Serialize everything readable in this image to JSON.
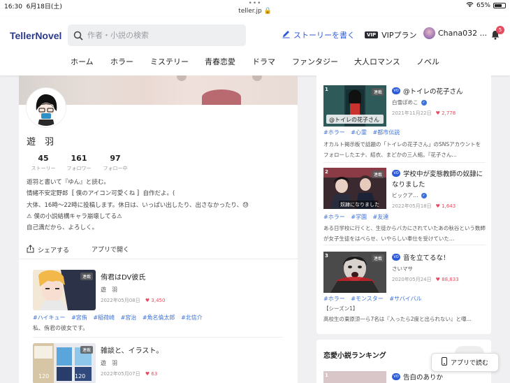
{
  "status": {
    "time": "16:30",
    "date": "6月18日(土)",
    "url": "teller.jp",
    "battery": "65%"
  },
  "header": {
    "logo": "TellerNovel",
    "search_placeholder": "作者・小説の検索",
    "write_label": "ストーリーを書く",
    "vip_tag": "VIP",
    "vip_label": "VIPプラン",
    "user_name": "Chana032 ...",
    "notification_count": "5"
  },
  "nav": [
    "ホーム",
    "ホラー",
    "ミステリー",
    "青春恋愛",
    "ドラマ",
    "ファンタジー",
    "大人ロマンス",
    "ノベル"
  ],
  "profile": {
    "name": "遊　羽",
    "stats": [
      {
        "value": "45",
        "label": "ストーリー"
      },
      {
        "value": "161",
        "label": "フォロワー"
      },
      {
        "value": "97",
        "label": "フォロー中"
      }
    ],
    "bio": [
      "遊羽と書いて『ゆん』と読む。",
      "情緒不安定野郎〚 僕のアイコン可愛くね 〛自作だよ。(",
      "大体、16時〜22時に投稿します。休日は、いっぱい出したり、出さなかったり、😓",
      "⚠ 僕の小説結構キャラ崩壊してる⚠",
      "自己満だから、よろしく。"
    ],
    "share_label": "シェアする",
    "open_app_label": "アプリで開く"
  },
  "stories": [
    {
      "badge": "連載",
      "title": "侑君はDV彼氏",
      "author": "遊　羽",
      "date": "2022年05月08日",
      "likes": "3,450",
      "tags": [
        "#ハイキュー",
        "#宮侑",
        "#稲荷崎",
        "#宮治",
        "#角名倫太郎",
        "#北信介"
      ],
      "desc": "私、侑君の彼女です。"
    },
    {
      "badge": "連載",
      "title": "雑談と、イラスト。",
      "author": "遊　羽",
      "date": "2022年05月07日",
      "likes": "63",
      "tags": [],
      "desc": ""
    }
  ],
  "ranking": [
    {
      "num": "1",
      "badge": "連載",
      "vo": "VO",
      "title": "@トイレの花子さん",
      "author": "白雪ぽめこ",
      "date": "2021年11月22日",
      "likes": "2,778",
      "tags": [
        "#ホラー",
        "#心霊",
        "#都市伝説"
      ],
      "desc": "オカルト掲示板で話題の「トイレの花子さん」のSNSアカウントをフォローしたエナ、結衣、まどかの三人組。『花子さん…"
    },
    {
      "num": "2",
      "badge": "連載",
      "vo": "VO",
      "title": "学校中が変態教師の奴隷に",
      "title2": "なりました",
      "author": "ビックア…",
      "date": "2022年05月18日",
      "likes": "1,643",
      "tags": [
        "#ホラー",
        "#学園",
        "#友達"
      ],
      "desc": "ある日学校に行くと、生徒からバカにされていたあの秋谷という数師が女子生徒をはべらせ、いやらしい奉仕を受けていた…"
    },
    {
      "num": "3",
      "badge": "連載",
      "vo": "VO",
      "title": "音を立てるな！",
      "author": "さいマサ",
      "date": "2020年05月24日",
      "likes": "88,833",
      "tags": [
        "#ホラー",
        "#モンスター",
        "#サバイバル"
      ],
      "desc_line1": "【シーズン1】",
      "desc_line2": "高校生の東原涼一ら7名は『入ったら2度と出られない』と噂…"
    }
  ],
  "ranking2": {
    "title": "恋愛小説ランキング",
    "first_num": "1",
    "first_vo": "VO",
    "first_title": "告白のありか"
  },
  "app_button": "アプリで読む"
}
